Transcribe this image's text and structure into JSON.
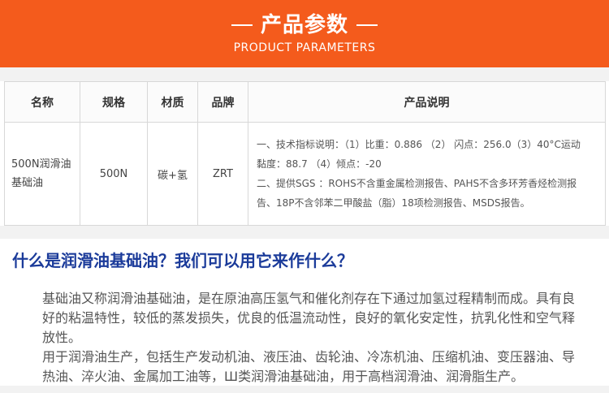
{
  "banner": {
    "title": "产品参数",
    "subtitle": "PRODUCT PARAMETERS"
  },
  "table": {
    "headers": [
      "名称",
      "规格",
      "材质",
      "品牌",
      "产品说明"
    ],
    "row": {
      "name": "500N润滑油基础油",
      "spec": "500N",
      "material": "碳+氢",
      "brand": "ZRT",
      "desc_lines": [
        "一、技术指标说明：（1）比重：0.886 （2） 闪点：256.0（3）40°C运动",
        "黏度：88.7 （4）倾点：-20",
        "二、提供SGS ：ROHS不含重金属检测报告、PAHS不含多环芳香烃检测报",
        "告、18P不含邻苯二甲酸盐（脂）18项检测报告、MSDS报告。"
      ]
    }
  },
  "question": "什么是润滑油基础油？我们可以用它来作什么？",
  "paragraphs": [
    "基础油又称润滑油基础油，是在原油高压氢气和催化剂存在下通过加氢过程精制而成。具有良好的粘温特性，较低的蒸发损失，优良的低温流动性，良好的氧化安定性，抗乳化性和空气释放性。",
    "用于润滑油生产，包括生产发动机油、液压油、齿轮油、冷冻机油、压缩机油、变压器油、导热油、淬火油、金属加工油等，Ш类润滑油基础油，用于高档润滑油、润滑脂生产。"
  ],
  "colors": {
    "banner": "#f45b1c",
    "question": "#1b3b9a"
  }
}
